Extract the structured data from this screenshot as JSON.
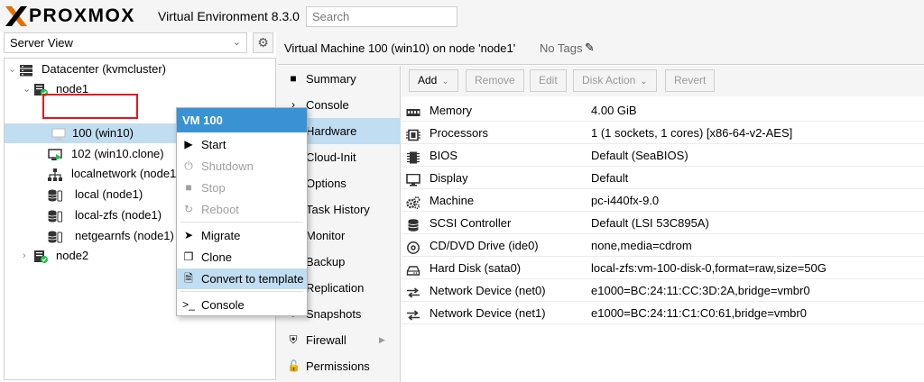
{
  "header": {
    "brand": "PROXMOX",
    "version": "Virtual Environment 8.3.0",
    "search_placeholder": "Search"
  },
  "left": {
    "view_select": "Server View",
    "tree": [
      {
        "label": "Datacenter (kvmcluster)",
        "icon": "datacenter-icon"
      },
      {
        "label": "node1",
        "icon": "node-online-icon"
      },
      {
        "label": "100 (win10)",
        "icon": "vm-icon",
        "selected": true
      },
      {
        "label": "102 (win10.clone)",
        "icon": "vm-running-icon"
      },
      {
        "label": "localnetwork (node1",
        "icon": "network-icon"
      },
      {
        "label": "local (node1)",
        "icon": "storage-icon"
      },
      {
        "label": "local-zfs (node1)",
        "icon": "storage-icon"
      },
      {
        "label": "netgearnfs (node1)",
        "icon": "storage-icon"
      },
      {
        "label": "node2",
        "icon": "node-online-icon"
      }
    ]
  },
  "vm": {
    "title": "Virtual Machine 100 (win10) on node 'node1'",
    "tags": "No Tags"
  },
  "nav": [
    {
      "label": "Summary",
      "icon": "book-icon"
    },
    {
      "label": "Console",
      "icon": "terminal-icon"
    },
    {
      "label": "Hardware",
      "icon": "desktop-icon",
      "active": true
    },
    {
      "label": "Cloud-Init",
      "icon": "cloud-icon"
    },
    {
      "label": "Options",
      "icon": "gear-icon"
    },
    {
      "label": "Task History",
      "icon": "list-icon"
    },
    {
      "label": "Monitor",
      "icon": "eye-icon"
    },
    {
      "label": "Backup",
      "icon": "floppy-icon"
    },
    {
      "label": "Replication",
      "icon": "retweet-icon"
    },
    {
      "label": "Snapshots",
      "icon": "history-icon"
    },
    {
      "label": "Firewall",
      "icon": "shield-icon",
      "expandable": true
    },
    {
      "label": "Permissions",
      "icon": "unlock-icon"
    }
  ],
  "toolbar": {
    "add": "Add",
    "remove": "Remove",
    "edit": "Edit",
    "disk_action": "Disk Action",
    "revert": "Revert"
  },
  "hardware": [
    {
      "name": "Memory",
      "value": "4.00 GiB",
      "icon": "memory-icon"
    },
    {
      "name": "Processors",
      "value": "1 (1 sockets, 1 cores) [x86-64-v2-AES]",
      "icon": "cpu-icon"
    },
    {
      "name": "BIOS",
      "value": "Default (SeaBIOS)",
      "icon": "microchip-icon"
    },
    {
      "name": "Display",
      "value": "Default",
      "icon": "display-icon"
    },
    {
      "name": "Machine",
      "value": "pc-i440fx-9.0",
      "icon": "cogs-icon"
    },
    {
      "name": "SCSI Controller",
      "value": "Default (LSI 53C895A)",
      "icon": "database-icon"
    },
    {
      "name": "CD/DVD Drive (ide0)",
      "value": "none,media=cdrom",
      "icon": "cdrom-icon"
    },
    {
      "name": "Hard Disk (sata0)",
      "value": "local-zfs:vm-100-disk-0,format=raw,size=50G",
      "icon": "hdd-icon"
    },
    {
      "name": "Network Device (net0)",
      "value": "e1000=BC:24:11:CC:3D:2A,bridge=vmbr0",
      "icon": "exchange-icon"
    },
    {
      "name": "Network Device (net1)",
      "value": "e1000=BC:24:11:C1:C0:61,bridge=vmbr0",
      "icon": "exchange-icon"
    }
  ],
  "context_menu": {
    "title": "VM 100",
    "items": [
      {
        "label": "Start",
        "icon": "play-icon",
        "disabled": false
      },
      {
        "label": "Shutdown",
        "icon": "power-icon",
        "disabled": true
      },
      {
        "label": "Stop",
        "icon": "stop-icon",
        "disabled": true
      },
      {
        "label": "Reboot",
        "icon": "refresh-icon",
        "disabled": true
      },
      {
        "label": "Migrate",
        "icon": "send-icon",
        "disabled": false
      },
      {
        "label": "Clone",
        "icon": "clone-icon",
        "disabled": false
      },
      {
        "label": "Convert to template",
        "icon": "file-icon",
        "disabled": false,
        "highlighted": true
      },
      {
        "label": "Console",
        "icon": "terminal-icon",
        "disabled": false
      }
    ]
  },
  "colors": {
    "accent": "#3892d4",
    "selection": "#c1ddf1",
    "highlight_box": "#e8141e",
    "logo_orange": "#e57000",
    "online_green": "#21bf4b"
  }
}
